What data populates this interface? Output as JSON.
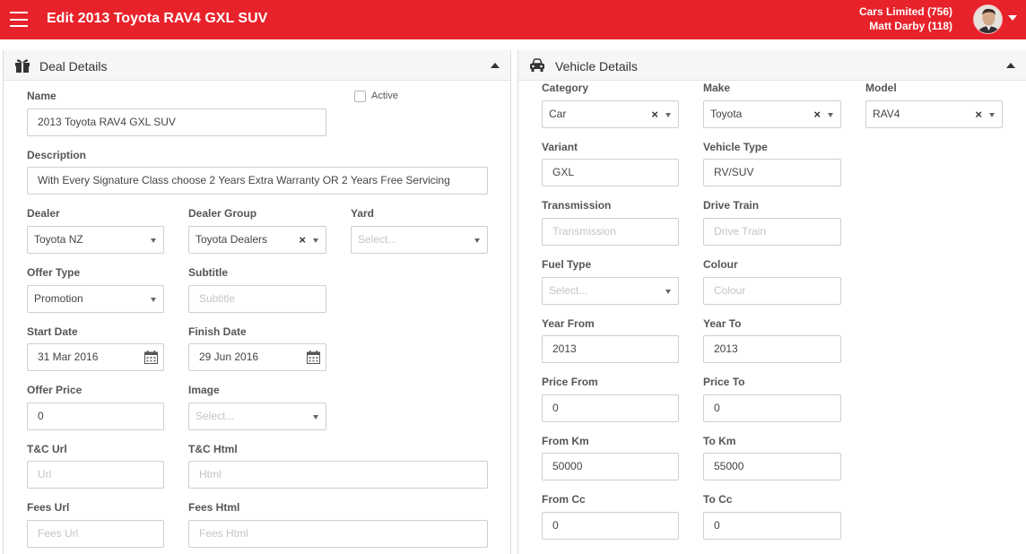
{
  "header": {
    "title": "Edit 2013 Toyota RAV4 GXL SUV",
    "account_line": "Cars Limited (756)",
    "user_line": "Matt Darby (118)"
  },
  "deal": {
    "title": "Deal Details",
    "name_label": "Name",
    "name_value": "2013 Toyota RAV4 GXL SUV",
    "active_label": "Active",
    "description_label": "Description",
    "description_value": "With Every Signature Class choose 2 Years Extra Warranty OR 2 Years Free Servicing",
    "dealer_label": "Dealer",
    "dealer_value": "Toyota NZ",
    "dealer_group_label": "Dealer Group",
    "dealer_group_value": "Toyota Dealers",
    "yard_label": "Yard",
    "yard_placeholder": "Select...",
    "offer_type_label": "Offer Type",
    "offer_type_value": "Promotion",
    "subtitle_label": "Subtitle",
    "subtitle_placeholder": "Subtitle",
    "start_date_label": "Start Date",
    "start_date_value": "31 Mar 2016",
    "finish_date_label": "Finish Date",
    "finish_date_value": "29 Jun 2016",
    "offer_price_label": "Offer Price",
    "offer_price_value": "0",
    "image_label": "Image",
    "image_placeholder": "Select...",
    "tc_url_label": "T&C Url",
    "tc_url_placeholder": "Url",
    "tc_html_label": "T&C Html",
    "tc_html_placeholder": "Html",
    "fees_url_label": "Fees Url",
    "fees_url_placeholder": "Fees Url",
    "fees_html_label": "Fees Html",
    "fees_html_placeholder": "Fees Html"
  },
  "vehicle": {
    "title": "Vehicle Details",
    "category_label": "Category",
    "category_value": "Car",
    "make_label": "Make",
    "make_value": "Toyota",
    "model_label": "Model",
    "model_value": "RAV4",
    "variant_label": "Variant",
    "variant_value": "GXL",
    "vehicle_type_label": "Vehicle Type",
    "vehicle_type_value": "RV/SUV",
    "transmission_label": "Transmission",
    "transmission_placeholder": "Transmission",
    "drive_train_label": "Drive Train",
    "drive_train_placeholder": "Drive Train",
    "fuel_type_label": "Fuel Type",
    "fuel_type_placeholder": "Select...",
    "colour_label": "Colour",
    "colour_placeholder": "Colour",
    "year_from_label": "Year From",
    "year_from_value": "2013",
    "year_to_label": "Year To",
    "year_to_value": "2013",
    "price_from_label": "Price From",
    "price_from_value": "0",
    "price_to_label": "Price To",
    "price_to_value": "0",
    "from_km_label": "From Km",
    "from_km_value": "50000",
    "to_km_label": "To Km",
    "to_km_value": "55000",
    "from_cc_label": "From Cc",
    "from_cc_value": "0",
    "to_cc_label": "To Cc",
    "to_cc_value": "0"
  },
  "icons": {
    "menu": "hamburger-menu-icon",
    "user_menu": "caret-down-icon",
    "deal_header": "gift-icon",
    "vehicle_header": "car-icon",
    "collapse": "caret-up-icon",
    "clear": "clear-x-icon",
    "dropdown": "caret-down-icon",
    "calendar": "calendar-icon"
  },
  "colors": {
    "brand_red": "#e8222a",
    "panel_header_bg": "#f6f6f6",
    "border": "#cfcfcf",
    "placeholder": "#c4c4c4"
  }
}
